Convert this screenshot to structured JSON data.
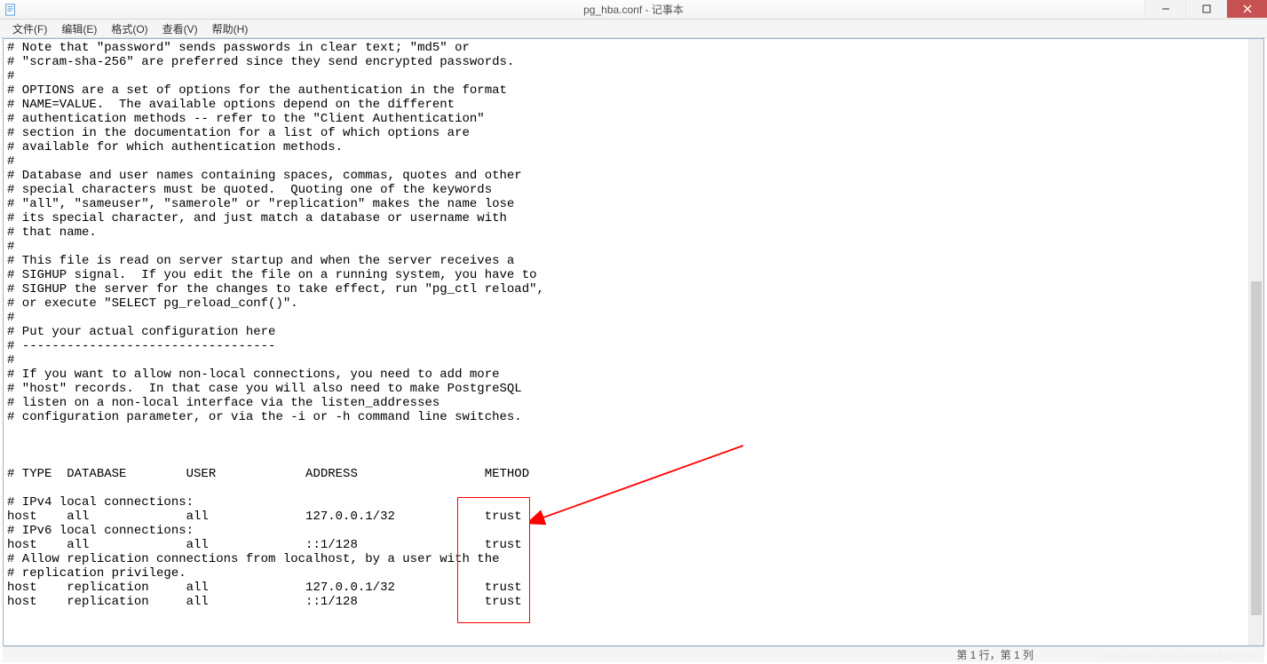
{
  "window": {
    "title": "pg_hba.conf - 记事本"
  },
  "menubar": {
    "file": "文件(F)",
    "edit": "编辑(E)",
    "format": "格式(O)",
    "view": "查看(V)",
    "help": "帮助(H)"
  },
  "editor": {
    "content": "# Note that \"password\" sends passwords in clear text; \"md5\" or\n# \"scram-sha-256\" are preferred since they send encrypted passwords.\n#\n# OPTIONS are a set of options for the authentication in the format\n# NAME=VALUE.  The available options depend on the different\n# authentication methods -- refer to the \"Client Authentication\"\n# section in the documentation for a list of which options are\n# available for which authentication methods.\n#\n# Database and user names containing spaces, commas, quotes and other\n# special characters must be quoted.  Quoting one of the keywords\n# \"all\", \"sameuser\", \"samerole\" or \"replication\" makes the name lose\n# its special character, and just match a database or username with\n# that name.\n#\n# This file is read on server startup and when the server receives a\n# SIGHUP signal.  If you edit the file on a running system, you have to\n# SIGHUP the server for the changes to take effect, run \"pg_ctl reload\",\n# or execute \"SELECT pg_reload_conf()\".\n#\n# Put your actual configuration here\n# ----------------------------------\n#\n# If you want to allow non-local connections, you need to add more\n# \"host\" records.  In that case you will also need to make PostgreSQL\n# listen on a non-local interface via the listen_addresses\n# configuration parameter, or via the -i or -h command line switches.\n\n\n\n# TYPE  DATABASE        USER            ADDRESS                 METHOD\n\n# IPv4 local connections:\nhost    all             all             127.0.0.1/32            trust\n# IPv6 local connections:\nhost    all             all             ::1/128                 trust\n# Allow replication connections from localhost, by a user with the\n# replication privilege.\nhost    replication     all             127.0.0.1/32            trust\nhost    replication     all             ::1/128                 trust"
  },
  "statusbar": {
    "position": "第 1 行，第 1 列"
  },
  "watermark": "https://blog.csdn.net/u013237351",
  "annotation": {
    "rect_color": "#ff0000",
    "arrow_color": "#ff0000"
  },
  "scrollbar": {
    "thumb_top_pct": 40,
    "thumb_height_pct": 55
  }
}
